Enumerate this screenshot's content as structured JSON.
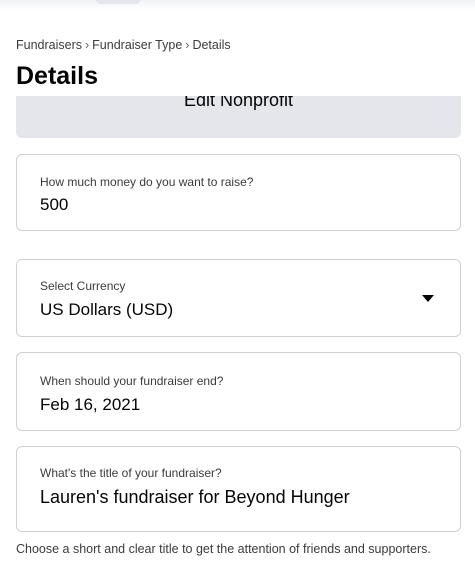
{
  "breadcrumb": {
    "items": [
      "Fundraisers",
      "Fundraiser Type",
      "Details"
    ],
    "separator": "›"
  },
  "page": {
    "title": "Details"
  },
  "edit_nonprofit": {
    "label": "Edit Nonprofit"
  },
  "fields": {
    "amount": {
      "label": "How much money do you want to raise?",
      "value": "500"
    },
    "currency": {
      "label": "Select Currency",
      "value": "US Dollars (USD)",
      "icon": "caret-down-icon"
    },
    "end_date": {
      "label": "When should your fundraiser end?",
      "value": "Feb 16, 2021"
    },
    "title": {
      "label": "What's the title of your fundraiser?",
      "value": "Lauren's fundraiser for Beyond Hunger"
    }
  },
  "helper_text": "Choose a short and clear title to get the attention of friends and supporters.",
  "colors": {
    "background": "#ffffff",
    "button_bg": "#e4e6eb",
    "field_border": "#ced0d4",
    "text_primary": "#050505",
    "text_secondary": "#3a3b3c"
  }
}
